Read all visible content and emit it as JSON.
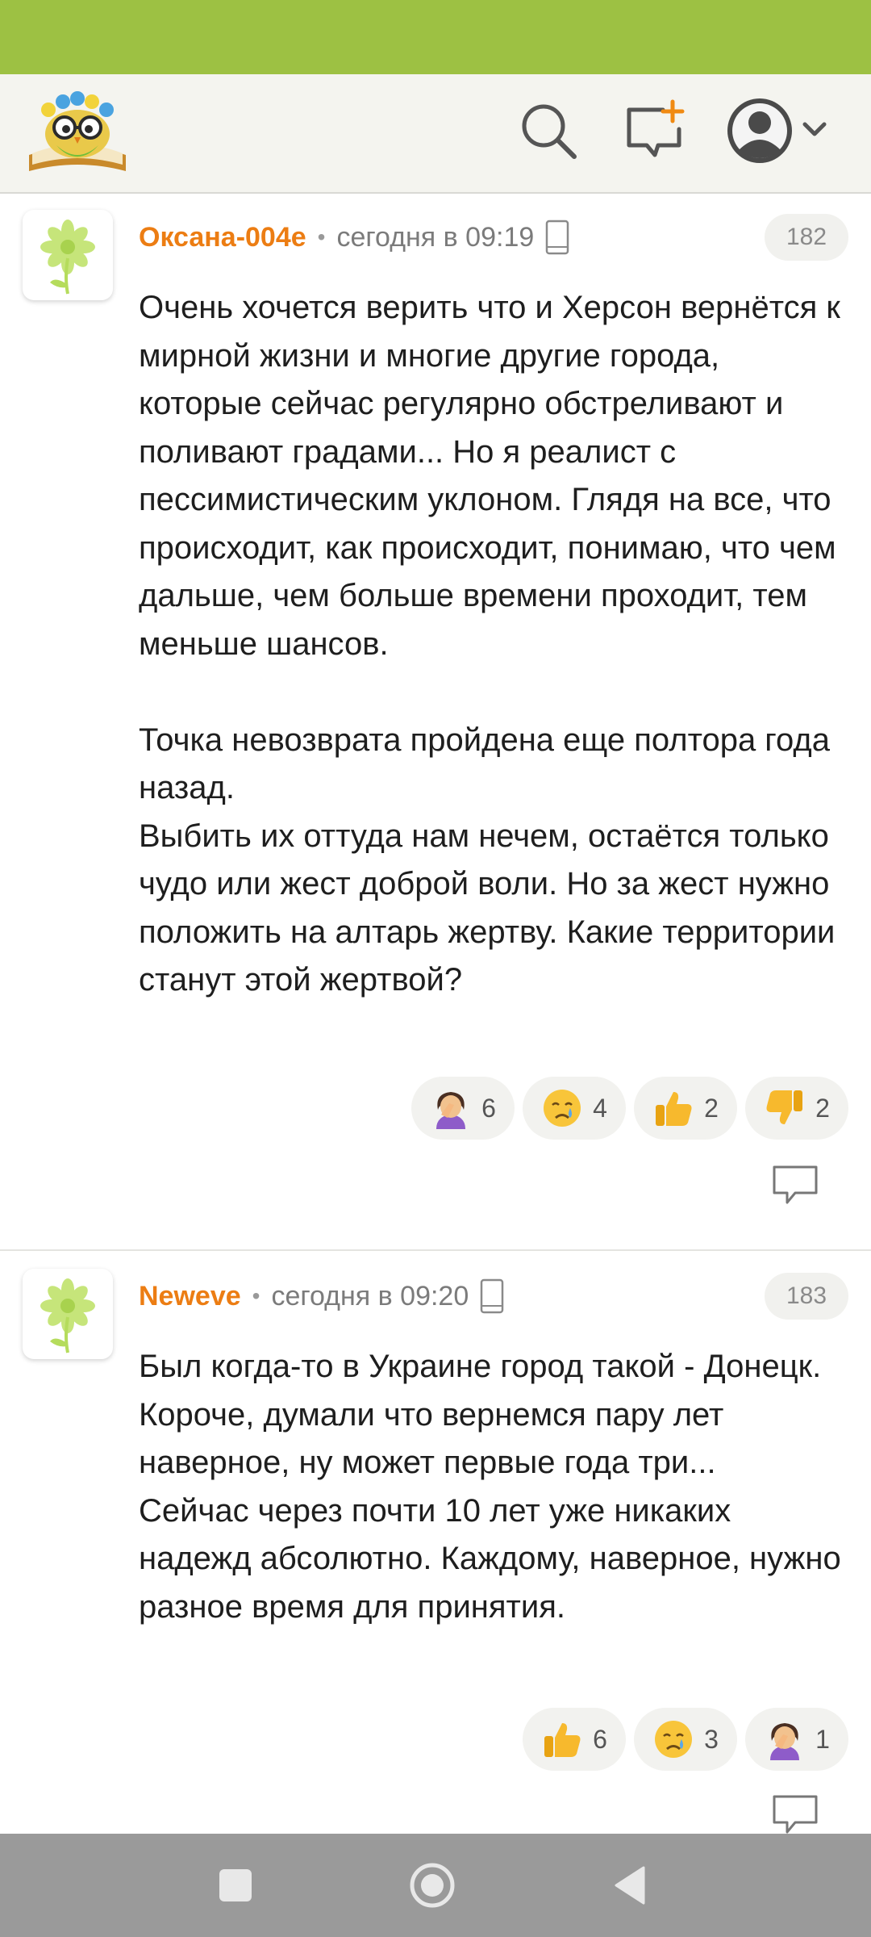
{
  "header": {
    "logo_icon": "owl-book-logo-icon",
    "search_icon": "search-icon",
    "compose_icon": "new-message-icon",
    "profile_icon": "user-avatar-icon",
    "dropdown_icon": "chevron-down-icon"
  },
  "comments": [
    {
      "author": "Оксана-004е",
      "separator": "•",
      "time": "сегодня в 09:19",
      "device_icon": "mobile-phone-icon",
      "number": "182",
      "paragraphs": [
        "Очень хочется верить что и Херсон вернётся к мирной жизни и многие другие города, которые сейчас регулярно обстреливают и поливают градами... Но я реалист с пессимистическим уклоном. Глядя на все, что происходит, как происходит, понимаю, что чем дальше, чем больше времени проходит, тем меньше шансов.",
        "Точка невозврата пройдена еще полтора года назад.",
        "Выбить их оттуда нам нечем, остаётся только чудо или жест доброй воли. Но за жест нужно положить на алтарь жертву. Какие территории станут этой жертвой?"
      ],
      "reactions": [
        {
          "icon": "facepalm-emoji",
          "count": "6"
        },
        {
          "icon": "crying-face-emoji",
          "count": "4"
        },
        {
          "icon": "thumbs-up-emoji",
          "count": "2"
        },
        {
          "icon": "thumbs-down-emoji",
          "count": "2"
        }
      ]
    },
    {
      "author": "Neweve",
      "separator": "•",
      "time": "сегодня в 09:20",
      "device_icon": "mobile-phone-icon",
      "number": "183",
      "paragraphs": [
        "Был когда-то в Украине город такой - Донецк. Короче, думали что вернемся пару лет наверное, ну может первые года три...",
        "Сейчас через почти 10 лет уже никаких надежд абсолютно. Каждому, наверное, нужно разное время для принятия."
      ],
      "reactions": [
        {
          "icon": "thumbs-up-emoji",
          "count": "6"
        },
        {
          "icon": "crying-face-emoji",
          "count": "3"
        },
        {
          "icon": "facepalm-emoji",
          "count": "1"
        }
      ]
    }
  ],
  "colors": {
    "status_bar": "#9dc143",
    "author": "#ec7d13",
    "nav_bar": "#9a9a9a"
  },
  "navbar": {
    "recents_icon": "square-recents-icon",
    "home_icon": "circle-home-icon",
    "back_icon": "triangle-back-icon"
  }
}
